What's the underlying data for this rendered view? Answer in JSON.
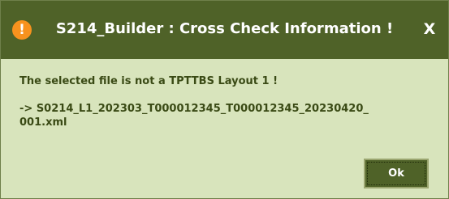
{
  "window": {
    "title": "S214_Builder : Cross Check Information !",
    "icon": "warning-icon",
    "close_label": "X"
  },
  "warning_icon_glyph": "!",
  "message": {
    "line1": "The selected file is not a TPTTBS Layout 1 !",
    "path_line1": "-> S0214_L1_202303_T000012345_T000012345_20230420_",
    "path_line2": "001.xml"
  },
  "buttons": {
    "ok_label": "Ok"
  },
  "colors": {
    "title_bar": "#4f6228",
    "dialog_background": "#d8e4bc",
    "text": "#3a4a15",
    "warning_icon": "#f7921e"
  }
}
